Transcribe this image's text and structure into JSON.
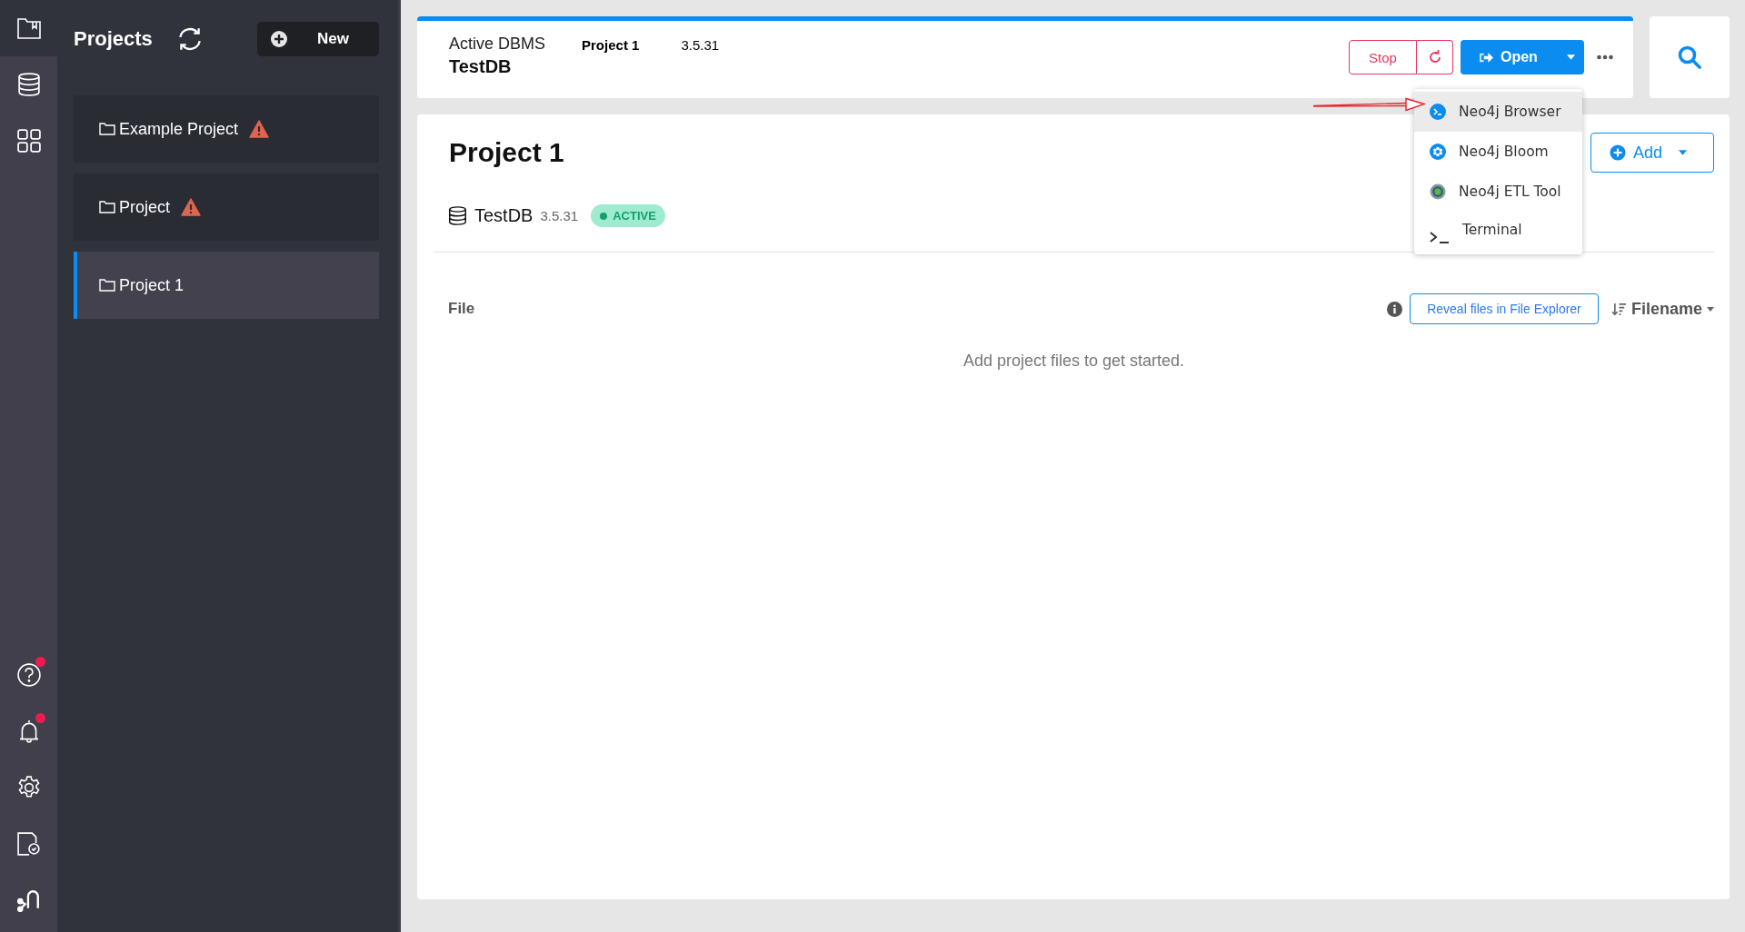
{
  "rail": {
    "top": [
      {
        "kind": "projects",
        "selected": true
      },
      {
        "kind": "databases",
        "selected": false
      },
      {
        "kind": "apps",
        "selected": false
      }
    ],
    "bottom": [
      {
        "kind": "help",
        "badge": true
      },
      {
        "kind": "notifications",
        "badge": true
      },
      {
        "kind": "settings",
        "badge": false
      },
      {
        "kind": "license",
        "badge": false
      },
      {
        "kind": "graph",
        "badge": false
      }
    ]
  },
  "projects_panel": {
    "title": "Projects",
    "new_button": "New",
    "items": [
      {
        "name": "Example Project",
        "warning": true,
        "selected": false
      },
      {
        "name": "Project",
        "warning": true,
        "selected": false
      },
      {
        "name": "Project 1",
        "warning": false,
        "selected": true
      }
    ]
  },
  "header": {
    "label": "Active DBMS",
    "db_name": "TestDB",
    "project": "Project 1",
    "version": "3.5.31",
    "stop_button": "Stop",
    "open_button": "Open"
  },
  "open_menu": {
    "items": [
      {
        "kind": "browser",
        "label": "Neo4j Browser",
        "selected": true
      },
      {
        "kind": "bloom",
        "label": "Neo4j Bloom",
        "selected": false
      },
      {
        "kind": "etl",
        "label": "Neo4j ETL Tool",
        "selected": false
      },
      {
        "kind": "terminal",
        "label": "Terminal",
        "selected": false
      }
    ]
  },
  "project": {
    "title": "Project 1",
    "add_button": "Add",
    "dbms": {
      "name": "TestDB",
      "version": "3.5.31",
      "status": "ACTIVE"
    }
  },
  "files": {
    "heading": "File",
    "reveal_button": "Reveal files in File Explorer",
    "sort_label": "Filename",
    "empty_message": "Add project files to get started."
  }
}
